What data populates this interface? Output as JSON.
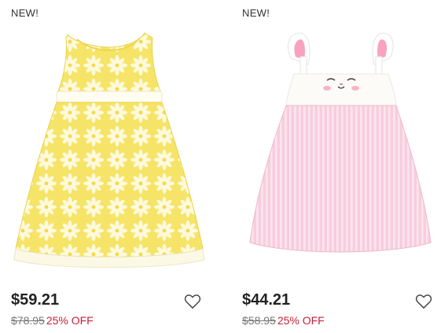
{
  "products": [
    {
      "badge": "NEW!",
      "price": "$59.21",
      "old_price": "$78.95",
      "discount": "25% OFF",
      "icon": "heart-outline-icon"
    },
    {
      "badge": "NEW!",
      "price": "$44.21",
      "old_price": "$58.95",
      "discount": "25% OFF",
      "icon": "heart-outline-icon"
    }
  ],
  "colors": {
    "price": "#222222",
    "old_price": "#777777",
    "discount": "#c8203a",
    "yellow_dress": "#f5e36a",
    "pink_dress": "#f6c3d6"
  }
}
